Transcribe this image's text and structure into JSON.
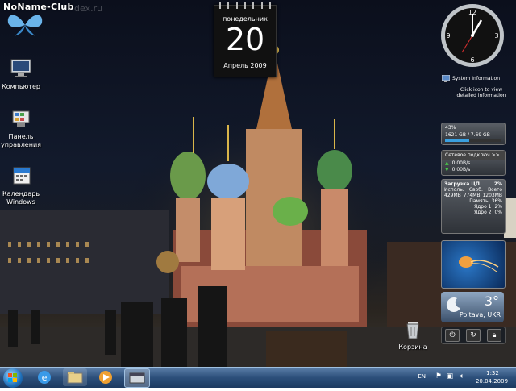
{
  "logo": {
    "text": "NoName-Club",
    "watermark": "dex.ru"
  },
  "desktop_icons": [
    {
      "label": "Компьютер"
    },
    {
      "label": "Панель управления"
    },
    {
      "label": "Календарь Windows"
    },
    {
      "label": "Корзина"
    }
  ],
  "calendar": {
    "weekday": "понедельник",
    "day": "20",
    "month_year": "Апрель 2009"
  },
  "clock": {
    "numerals": [
      "12",
      "3",
      "6",
      "9"
    ]
  },
  "system_info": {
    "title": "System Information",
    "hint_line1": "Click icon to view",
    "hint_line2": "detailed information"
  },
  "disk": {
    "percent": "43%",
    "usage": "1621 GB / 7.69 GB",
    "fill_fraction": 0.43
  },
  "network": {
    "title": "Сетевое подключ >>",
    "down": "0.00B/s",
    "up": "0.00B/s"
  },
  "cpu": {
    "title": "Загрузка ЦП",
    "total": "2%",
    "mem_headers": [
      "Исполь.",
      "Своб.",
      "Всего"
    ],
    "mem_values": [
      "429MB",
      "774MB",
      "1203MB"
    ],
    "rows": [
      {
        "label": "Память",
        "value": "36%"
      },
      {
        "label": "Ядро 1",
        "value": "2%"
      },
      {
        "label": "Ядро 2",
        "value": "0%"
      }
    ]
  },
  "weather": {
    "temp": "3°",
    "city": "Poltava, UKR"
  },
  "taskbar": {
    "lang": "EN",
    "time": "1:32",
    "date": "20.04.2009"
  }
}
